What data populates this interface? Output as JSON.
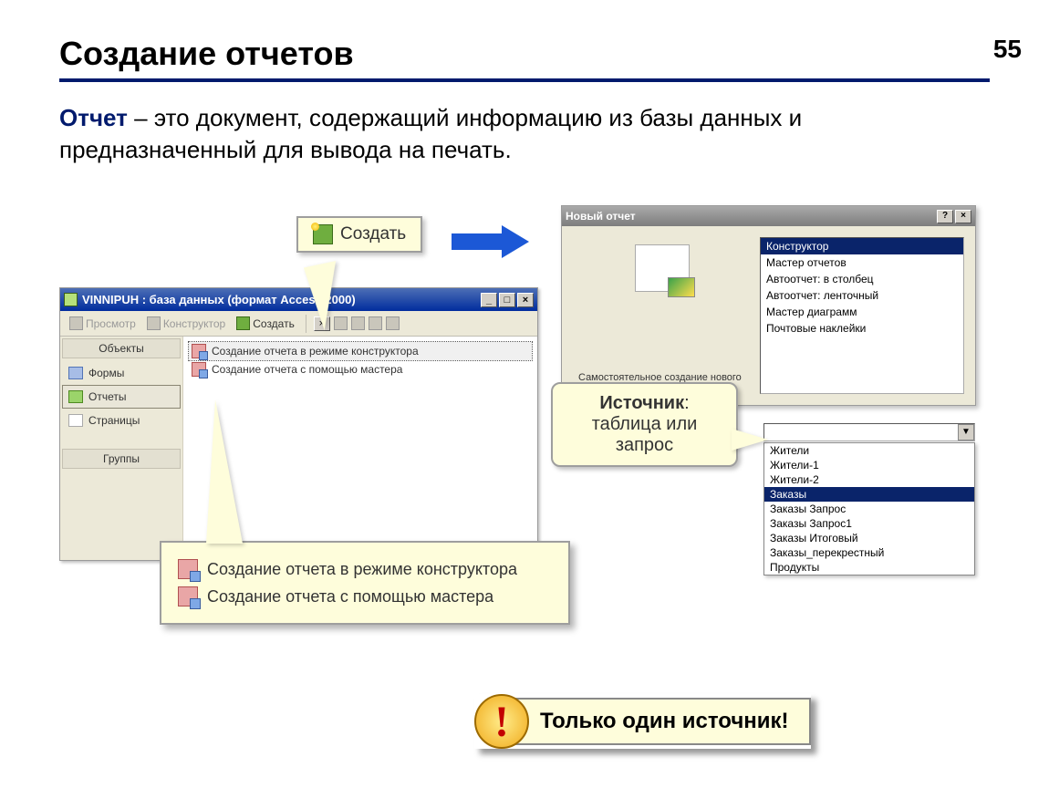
{
  "page": {
    "number": "55",
    "title": "Создание отчетов"
  },
  "definition": {
    "term": "Отчет",
    "rest": " – это документ, содержащий информацию из базы данных и предназначенный для вывода на печать."
  },
  "db_window": {
    "title": "VINNIPUH : база данных (формат Access 2000)",
    "toolbar": {
      "preview": "Просмотр",
      "design": "Конструктор",
      "create": "Создать"
    },
    "sidebar": {
      "header": "Объекты",
      "items": [
        "Формы",
        "Отчеты",
        "Страницы"
      ],
      "groups": "Группы"
    },
    "list": [
      "Создание отчета в режиме конструктора",
      "Создание отчета с помощью мастера"
    ]
  },
  "create_button_label": "Создать",
  "new_report_dialog": {
    "title": "Новый отчет",
    "description": "Самостоятельное создание нового отчета.",
    "options": [
      "Конструктор",
      "Мастер отчетов",
      "Автоотчет: в столбец",
      "Автоотчет: ленточный",
      "Мастер диаграмм",
      "Почтовые наклейки"
    ]
  },
  "source_callout": {
    "label": "Источник",
    "desc": "таблица или запрос"
  },
  "tables": [
    "Жители",
    "Жители-1",
    "Жители-2",
    "Заказы",
    "Заказы Запрос",
    "Заказы Запрос1",
    "Заказы Итоговый",
    "Заказы_перекрестный",
    "Продукты"
  ],
  "tables_selected_index": 3,
  "zoom": {
    "rows": [
      "Создание отчета в режиме конструктора",
      "Создание отчета с помощью мастера"
    ]
  },
  "alert": {
    "mark": "!",
    "text": "Только один источник!"
  }
}
